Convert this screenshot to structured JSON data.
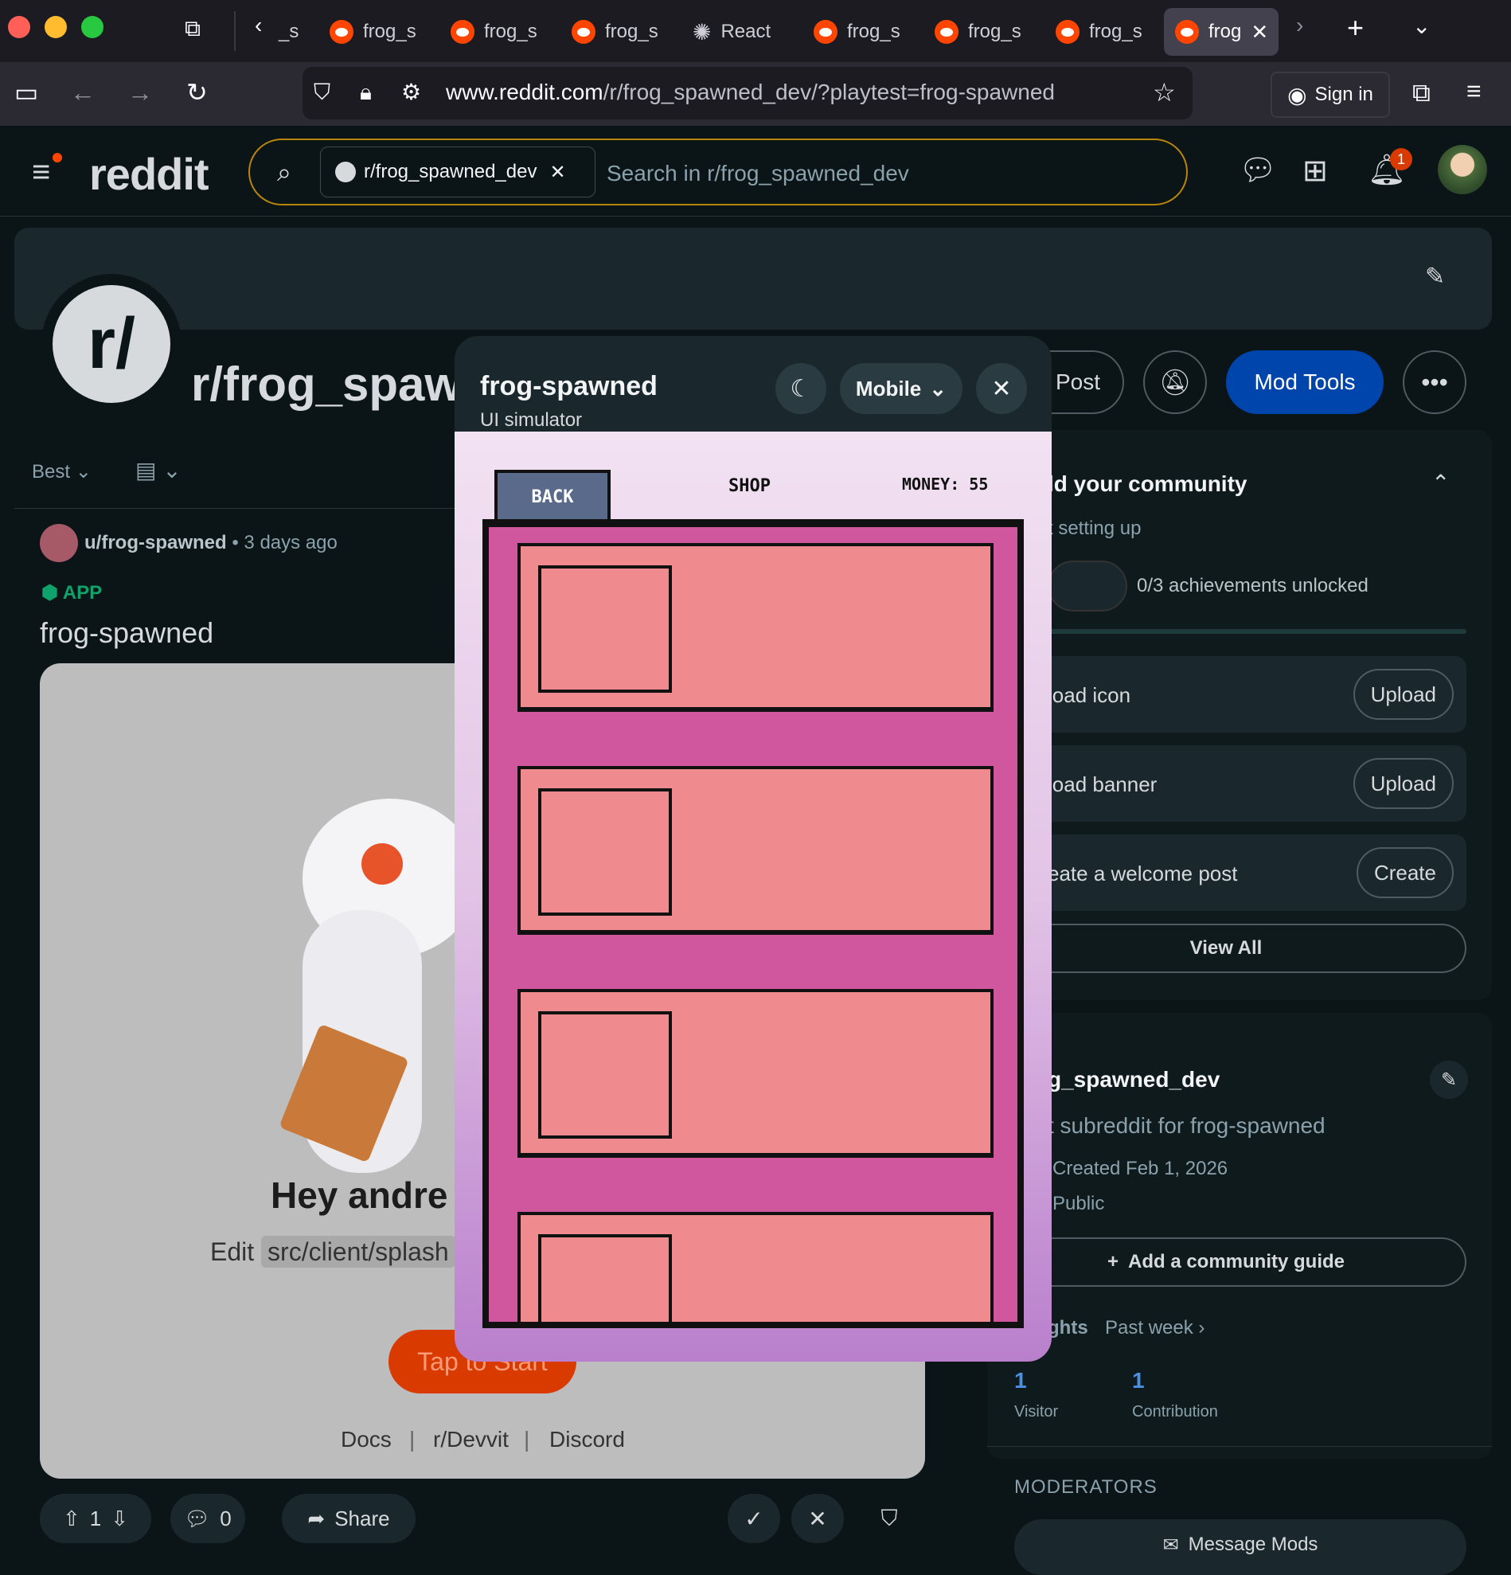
{
  "browser": {
    "tabs": [
      {
        "label": "_s"
      },
      {
        "label": "frog_s"
      },
      {
        "label": "frog_s"
      },
      {
        "label": "frog_s"
      },
      {
        "label": "React"
      },
      {
        "label": "frog_s"
      },
      {
        "label": "frog_s"
      },
      {
        "label": "frog_s"
      },
      {
        "label": "frog"
      }
    ],
    "url_prefix": "www.reddit.com",
    "url_path": "/r/frog_spawned_dev/?playtest=frog-spawned",
    "sign_in": "Sign in"
  },
  "reddit": {
    "logo": "reddit",
    "search_chip": "r/frog_spawned_dev",
    "search_placeholder": "Search in r/frog_spawned_dev",
    "notif_count": "1"
  },
  "subreddit": {
    "name": "r/frog_spawned_dev",
    "icon_text": "r/",
    "post_button": "Post",
    "mod_tools": "Mod Tools"
  },
  "feed": {
    "sort": "Best",
    "post": {
      "author": "u/frog-spawned",
      "time": "3 days ago",
      "badge": "APP",
      "title": "frog-spawned",
      "splash_heading": "Hey andre",
      "splash_edit": "Edit",
      "splash_path": "src/client/splash",
      "start_button": "Tap to Start",
      "links": [
        "Docs",
        "r/Devvit",
        "Discord"
      ],
      "votes": "1",
      "comments": "0",
      "share": "Share"
    }
  },
  "sidebar": {
    "build_title": "ld your community",
    "build_sub": "t setting up",
    "achievements": "0/3 achievements unlocked",
    "tasks": [
      {
        "label": "load icon",
        "button": "Upload"
      },
      {
        "label": "load banner",
        "button": "Upload"
      },
      {
        "label": "eate a welcome post",
        "button": "Create"
      }
    ],
    "view_all": "View All",
    "about_name": "g_spawned_dev",
    "about_desc": "t subreddit for frog-spawned",
    "created": "Created Feb 1, 2026",
    "visibility": "Public",
    "guide": "Add a community guide",
    "insights": "ghts",
    "insights_range": "Past week",
    "stats": [
      {
        "value": "1",
        "label": "Visitor"
      },
      {
        "value": "1",
        "label": "Contribution"
      }
    ],
    "moderators_title": "MODERATORS",
    "message_mods": "Message Mods"
  },
  "simulator": {
    "title": "frog-spawned",
    "subtitle": "UI simulator",
    "device": "Mobile",
    "game": {
      "back": "BACK",
      "screen": "SHOP",
      "money": "MONEY: 55",
      "items": 4
    }
  },
  "colors": {
    "accent": "#0045ac",
    "brand": "#ff4500",
    "shop_bg": "#d0579d",
    "item_bg": "#ef8a8f"
  }
}
